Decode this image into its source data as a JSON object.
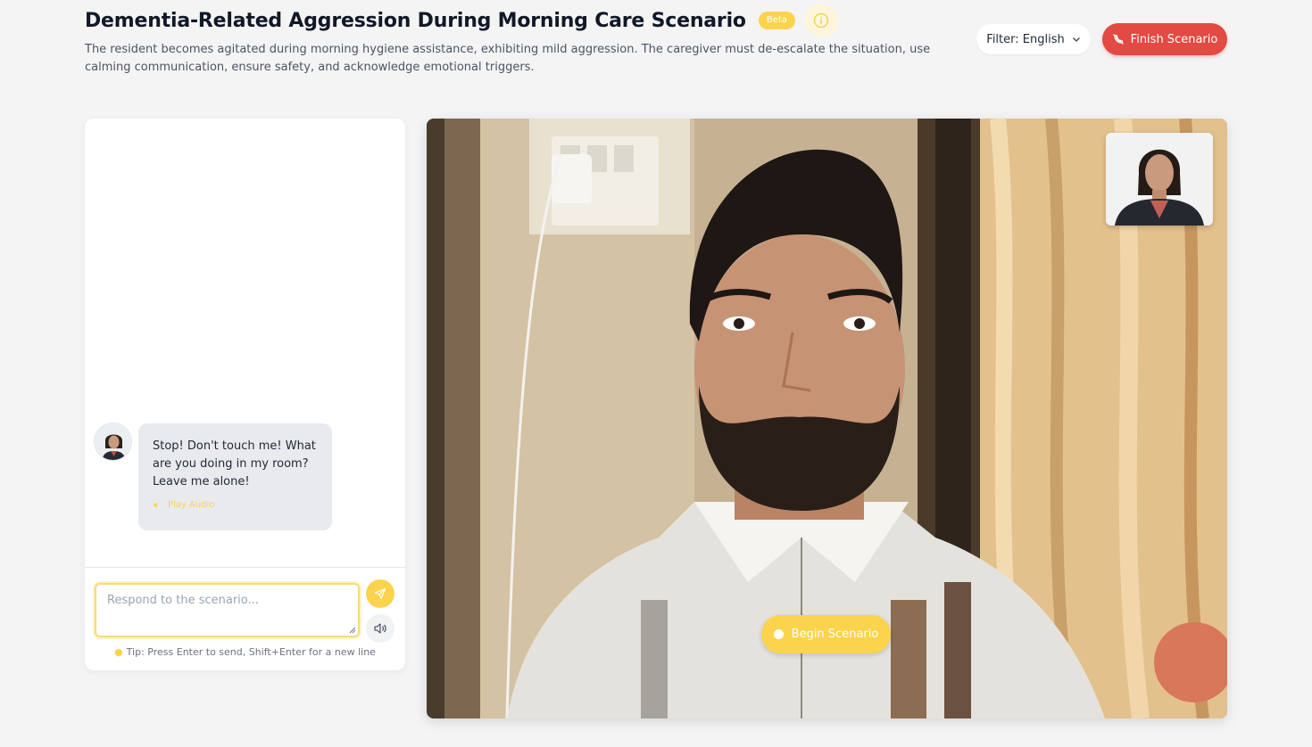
{
  "header": {
    "title": "Dementia-Related Aggression During Morning Care Scenario",
    "badge": "Beta",
    "description": "The resident becomes agitated during morning hygiene assistance, exhibiting mild aggression. The caregiver must de-escalate the situation, use calming communication, ensure safety, and acknowledge emotional triggers."
  },
  "toolbar": {
    "filter_label": "Filter: English",
    "finish_label": "Finish Scenario"
  },
  "chat": {
    "messages": [
      {
        "text": "Stop! Don't touch me! What are you doing in my room? Leave me alone!",
        "play_audio_label": "Play Audio"
      }
    ],
    "input_placeholder": "Respond to the scenario...",
    "tip": "Tip: Press Enter to send, Shift+Enter for a new line"
  },
  "video": {
    "begin_label": "Begin Scenario"
  },
  "colors": {
    "accent": "#fcd34d",
    "danger": "#e24a43"
  }
}
